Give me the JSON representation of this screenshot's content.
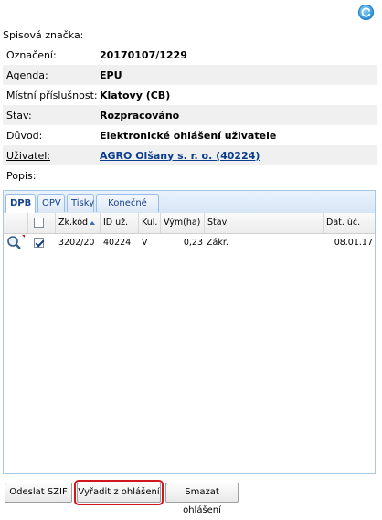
{
  "header": {
    "spisova_znacka_label": "Spisová značka:"
  },
  "form": {
    "oznaceni": {
      "label": "Označení:",
      "value": "20170107/1229"
    },
    "agenda": {
      "label": "Agenda:",
      "value": "EPU"
    },
    "mistni": {
      "label": "Místní příslušnost:",
      "value": "Klatovy (CB)"
    },
    "stav": {
      "label": "Stav:",
      "value": "Rozpracováno"
    },
    "duvod": {
      "label": "Důvod:",
      "value": "Elektronické ohlášení uživatele"
    },
    "uzivatel": {
      "label": "Uživatel:",
      "value": "AGRO Olšany s. r. o. (40224)"
    },
    "popis": {
      "label": "Popis:",
      "value": ""
    }
  },
  "tabs": [
    {
      "label": "DPB",
      "active": true
    },
    {
      "label": "OPV",
      "active": false
    },
    {
      "label": "Tisky",
      "active": false
    },
    {
      "label": "Konečné tisky",
      "active": false
    }
  ],
  "grid": {
    "columns": [
      "Zk.kód",
      "ID už.",
      "Kul.",
      "Vým(ha)",
      "Stav",
      "Dat. úč."
    ],
    "rows": [
      {
        "checked": true,
        "zk_kod": "3202/20",
        "id_uz": "40224",
        "kul": "V",
        "vym": "0,23",
        "stav": "Zákr.",
        "dat": "08.01.17"
      }
    ]
  },
  "buttons": {
    "odeslat": "Odeslat SZIF",
    "vyradit": "Vyřadit z ohlášení",
    "smazat": "Smazat ohlášení"
  },
  "icons": {
    "refresh": "refresh-icon",
    "search": "magnifier-icon"
  },
  "colors": {
    "highlight": "#d2161e",
    "link": "#0a3d8f",
    "tab_text": "#15428b"
  }
}
